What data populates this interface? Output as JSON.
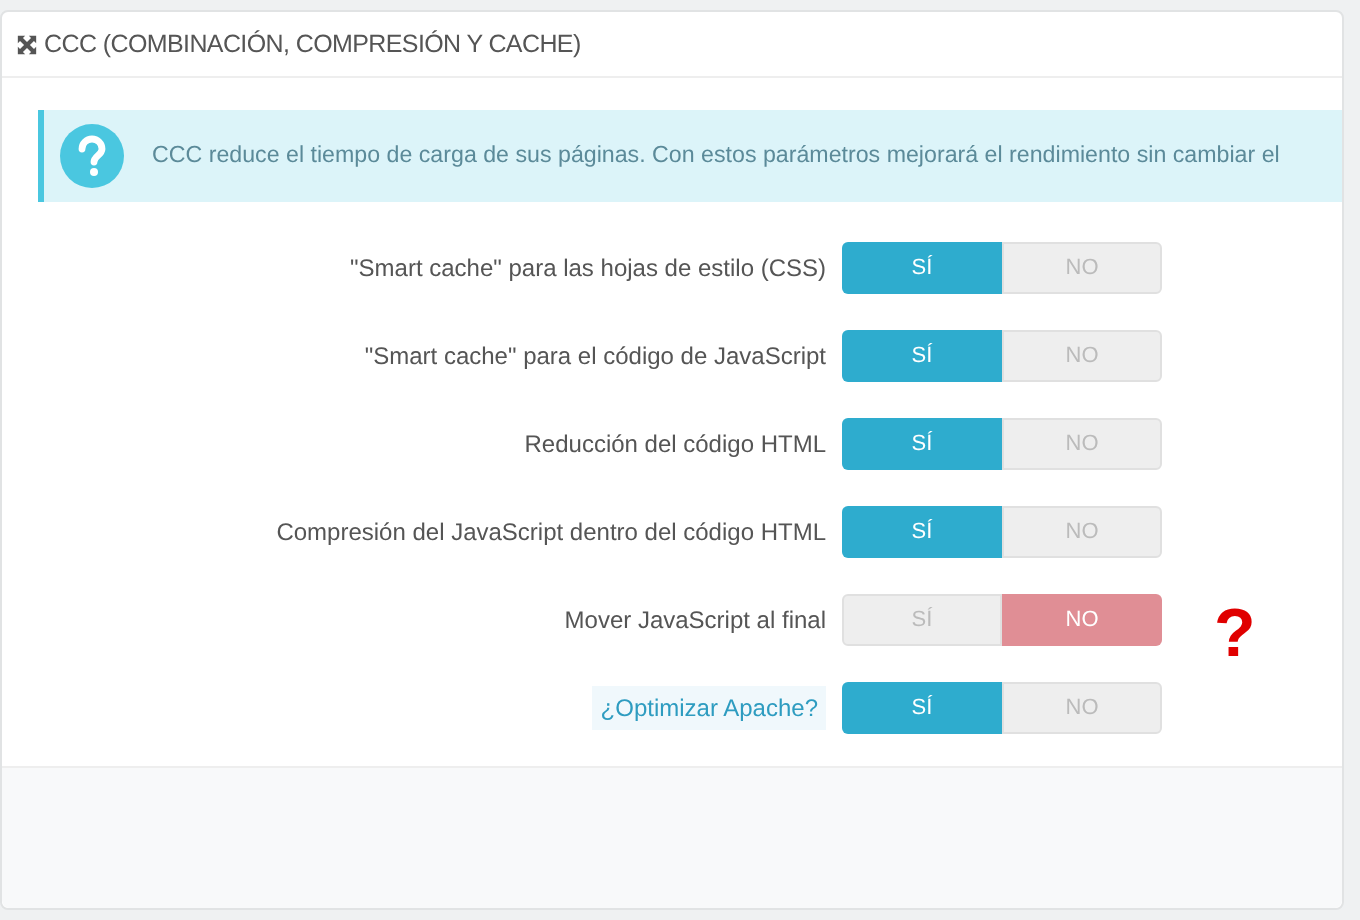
{
  "panel": {
    "title": "CCC (COMBINACIÓN, COMPRESIÓN Y CACHE)"
  },
  "alert": {
    "text": "CCC reduce el tiempo de carga de sus páginas. Con estos parámetros mejorará el rendimiento sin cambiar el"
  },
  "rows": [
    {
      "label": "\"Smart cache\" para las hojas de estilo (CSS)",
      "hint": false,
      "options": [
        {
          "label": "SÍ",
          "kind": "yes",
          "selected": true
        },
        {
          "label": "NO",
          "kind": "no",
          "selected": false
        }
      ]
    },
    {
      "label": "\"Smart cache\" para el código de JavaScript",
      "hint": false,
      "options": [
        {
          "label": "SÍ",
          "kind": "yes",
          "selected": true
        },
        {
          "label": "NO",
          "kind": "no",
          "selected": false
        }
      ]
    },
    {
      "label": "Reducción del código HTML",
      "hint": false,
      "options": [
        {
          "label": "SÍ",
          "kind": "yes",
          "selected": true
        },
        {
          "label": "NO",
          "kind": "no",
          "selected": false
        }
      ]
    },
    {
      "label": "Compresión del JavaScript dentro del código HTML",
      "hint": false,
      "options": [
        {
          "label": "SÍ",
          "kind": "yes",
          "selected": true
        },
        {
          "label": "NO",
          "kind": "no",
          "selected": false
        }
      ]
    },
    {
      "label": "Mover JavaScript al final",
      "hint": false,
      "annotation": "?",
      "options": [
        {
          "label": "SÍ",
          "kind": "yes",
          "selected": false
        },
        {
          "label": "NO",
          "kind": "no",
          "selected": true
        }
      ]
    },
    {
      "label": "¿Optimizar Apache?",
      "hint": true,
      "options": [
        {
          "label": "SÍ",
          "kind": "yes",
          "selected": true
        },
        {
          "label": "NO",
          "kind": "no",
          "selected": false
        }
      ]
    }
  ]
}
